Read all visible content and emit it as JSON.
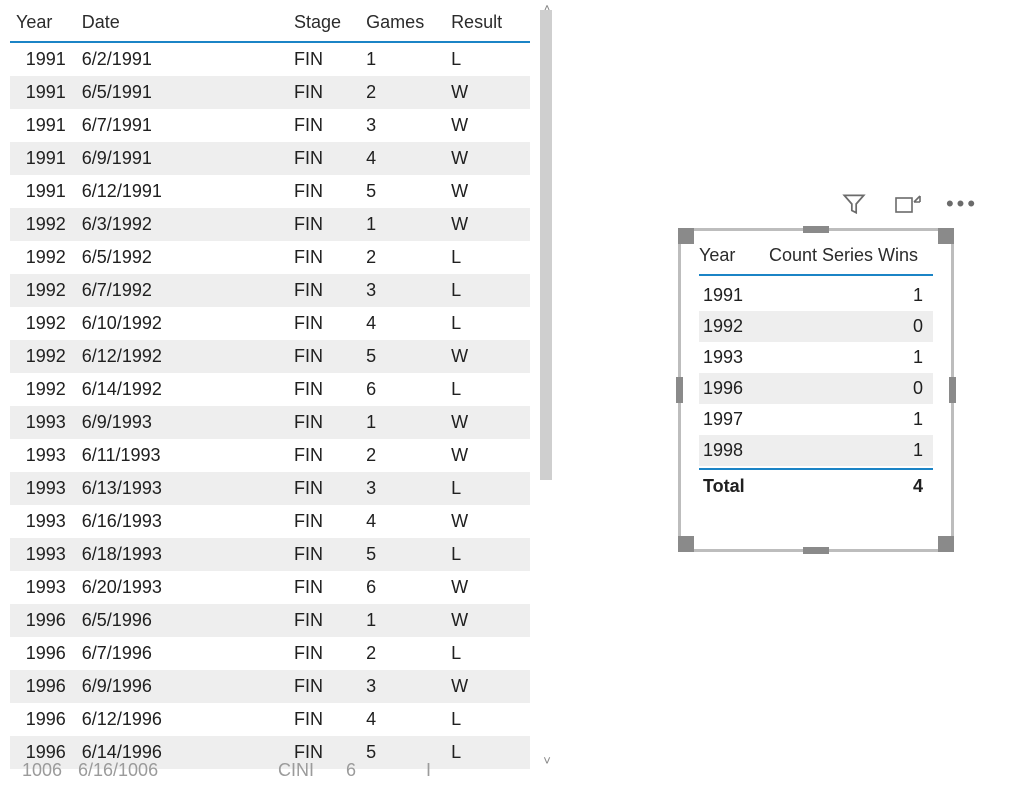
{
  "left_table": {
    "headers": {
      "year": "Year",
      "date": "Date",
      "stage": "Stage",
      "games": "Games",
      "result": "Result"
    },
    "rows": [
      {
        "year": "1991",
        "date": "6/2/1991",
        "stage": "FIN",
        "games": "1",
        "result": "L"
      },
      {
        "year": "1991",
        "date": "6/5/1991",
        "stage": "FIN",
        "games": "2",
        "result": "W"
      },
      {
        "year": "1991",
        "date": "6/7/1991",
        "stage": "FIN",
        "games": "3",
        "result": "W"
      },
      {
        "year": "1991",
        "date": "6/9/1991",
        "stage": "FIN",
        "games": "4",
        "result": "W"
      },
      {
        "year": "1991",
        "date": "6/12/1991",
        "stage": "FIN",
        "games": "5",
        "result": "W"
      },
      {
        "year": "1992",
        "date": "6/3/1992",
        "stage": "FIN",
        "games": "1",
        "result": "W"
      },
      {
        "year": "1992",
        "date": "6/5/1992",
        "stage": "FIN",
        "games": "2",
        "result": "L"
      },
      {
        "year": "1992",
        "date": "6/7/1992",
        "stage": "FIN",
        "games": "3",
        "result": "L"
      },
      {
        "year": "1992",
        "date": "6/10/1992",
        "stage": "FIN",
        "games": "4",
        "result": "L"
      },
      {
        "year": "1992",
        "date": "6/12/1992",
        "stage": "FIN",
        "games": "5",
        "result": "W"
      },
      {
        "year": "1992",
        "date": "6/14/1992",
        "stage": "FIN",
        "games": "6",
        "result": "L"
      },
      {
        "year": "1993",
        "date": "6/9/1993",
        "stage": "FIN",
        "games": "1",
        "result": "W"
      },
      {
        "year": "1993",
        "date": "6/11/1993",
        "stage": "FIN",
        "games": "2",
        "result": "W"
      },
      {
        "year": "1993",
        "date": "6/13/1993",
        "stage": "FIN",
        "games": "3",
        "result": "L"
      },
      {
        "year": "1993",
        "date": "6/16/1993",
        "stage": "FIN",
        "games": "4",
        "result": "W"
      },
      {
        "year": "1993",
        "date": "6/18/1993",
        "stage": "FIN",
        "games": "5",
        "result": "L"
      },
      {
        "year": "1993",
        "date": "6/20/1993",
        "stage": "FIN",
        "games": "6",
        "result": "W"
      },
      {
        "year": "1996",
        "date": "6/5/1996",
        "stage": "FIN",
        "games": "1",
        "result": "W"
      },
      {
        "year": "1996",
        "date": "6/7/1996",
        "stage": "FIN",
        "games": "2",
        "result": "L"
      },
      {
        "year": "1996",
        "date": "6/9/1996",
        "stage": "FIN",
        "games": "3",
        "result": "W"
      },
      {
        "year": "1996",
        "date": "6/12/1996",
        "stage": "FIN",
        "games": "4",
        "result": "L"
      },
      {
        "year": "1996",
        "date": "6/14/1996",
        "stage": "FIN",
        "games": "5",
        "result": "L"
      }
    ],
    "cutoff_row": {
      "year": "1006",
      "date": "6/16/1006",
      "stage": "CINI",
      "games": "6",
      "result": "I"
    }
  },
  "right_table": {
    "headers": {
      "year": "Year",
      "count": "Count Series Wins"
    },
    "rows": [
      {
        "year": "1991",
        "count": "1"
      },
      {
        "year": "1992",
        "count": "0"
      },
      {
        "year": "1993",
        "count": "1"
      },
      {
        "year": "1996",
        "count": "0"
      },
      {
        "year": "1997",
        "count": "1"
      },
      {
        "year": "1998",
        "count": "1"
      }
    ],
    "total_label": "Total",
    "total_value": "4"
  },
  "toolbar": {
    "filter": "filter-icon",
    "focus": "focus-mode-icon",
    "more": "more-options-icon"
  },
  "colors": {
    "accent": "#1b84c6"
  }
}
